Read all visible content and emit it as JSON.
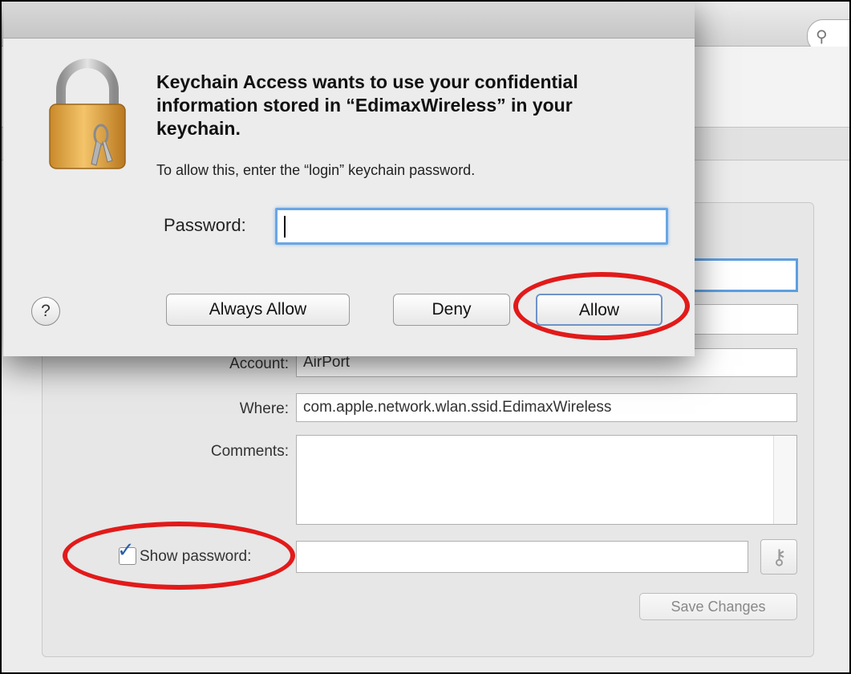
{
  "search": {
    "icon": "search-icon"
  },
  "dialog": {
    "title": "Keychain Access wants to use your confidential information stored in “EdimaxWireless” in your keychain.",
    "subtitle": "To allow this, enter the “login” keychain password.",
    "password_label": "Password:",
    "password_value": "",
    "help_label": "?",
    "buttons": {
      "always_allow": "Always Allow",
      "deny": "Deny",
      "allow": "Allow"
    }
  },
  "form": {
    "account_label": "Account:",
    "account_value": "AirPort",
    "where_label": "Where:",
    "where_value": "com.apple.network.wlan.ssid.EdimaxWireless",
    "comments_label": "Comments:",
    "comments_value": "",
    "show_password_label": "Show password:",
    "show_password_checked": true,
    "password_value": "",
    "save_label": "Save Changes"
  },
  "colors": {
    "annotation": "#e21a1a",
    "focus": "#5d9ee0",
    "checkbox": "#2d5fa8"
  }
}
